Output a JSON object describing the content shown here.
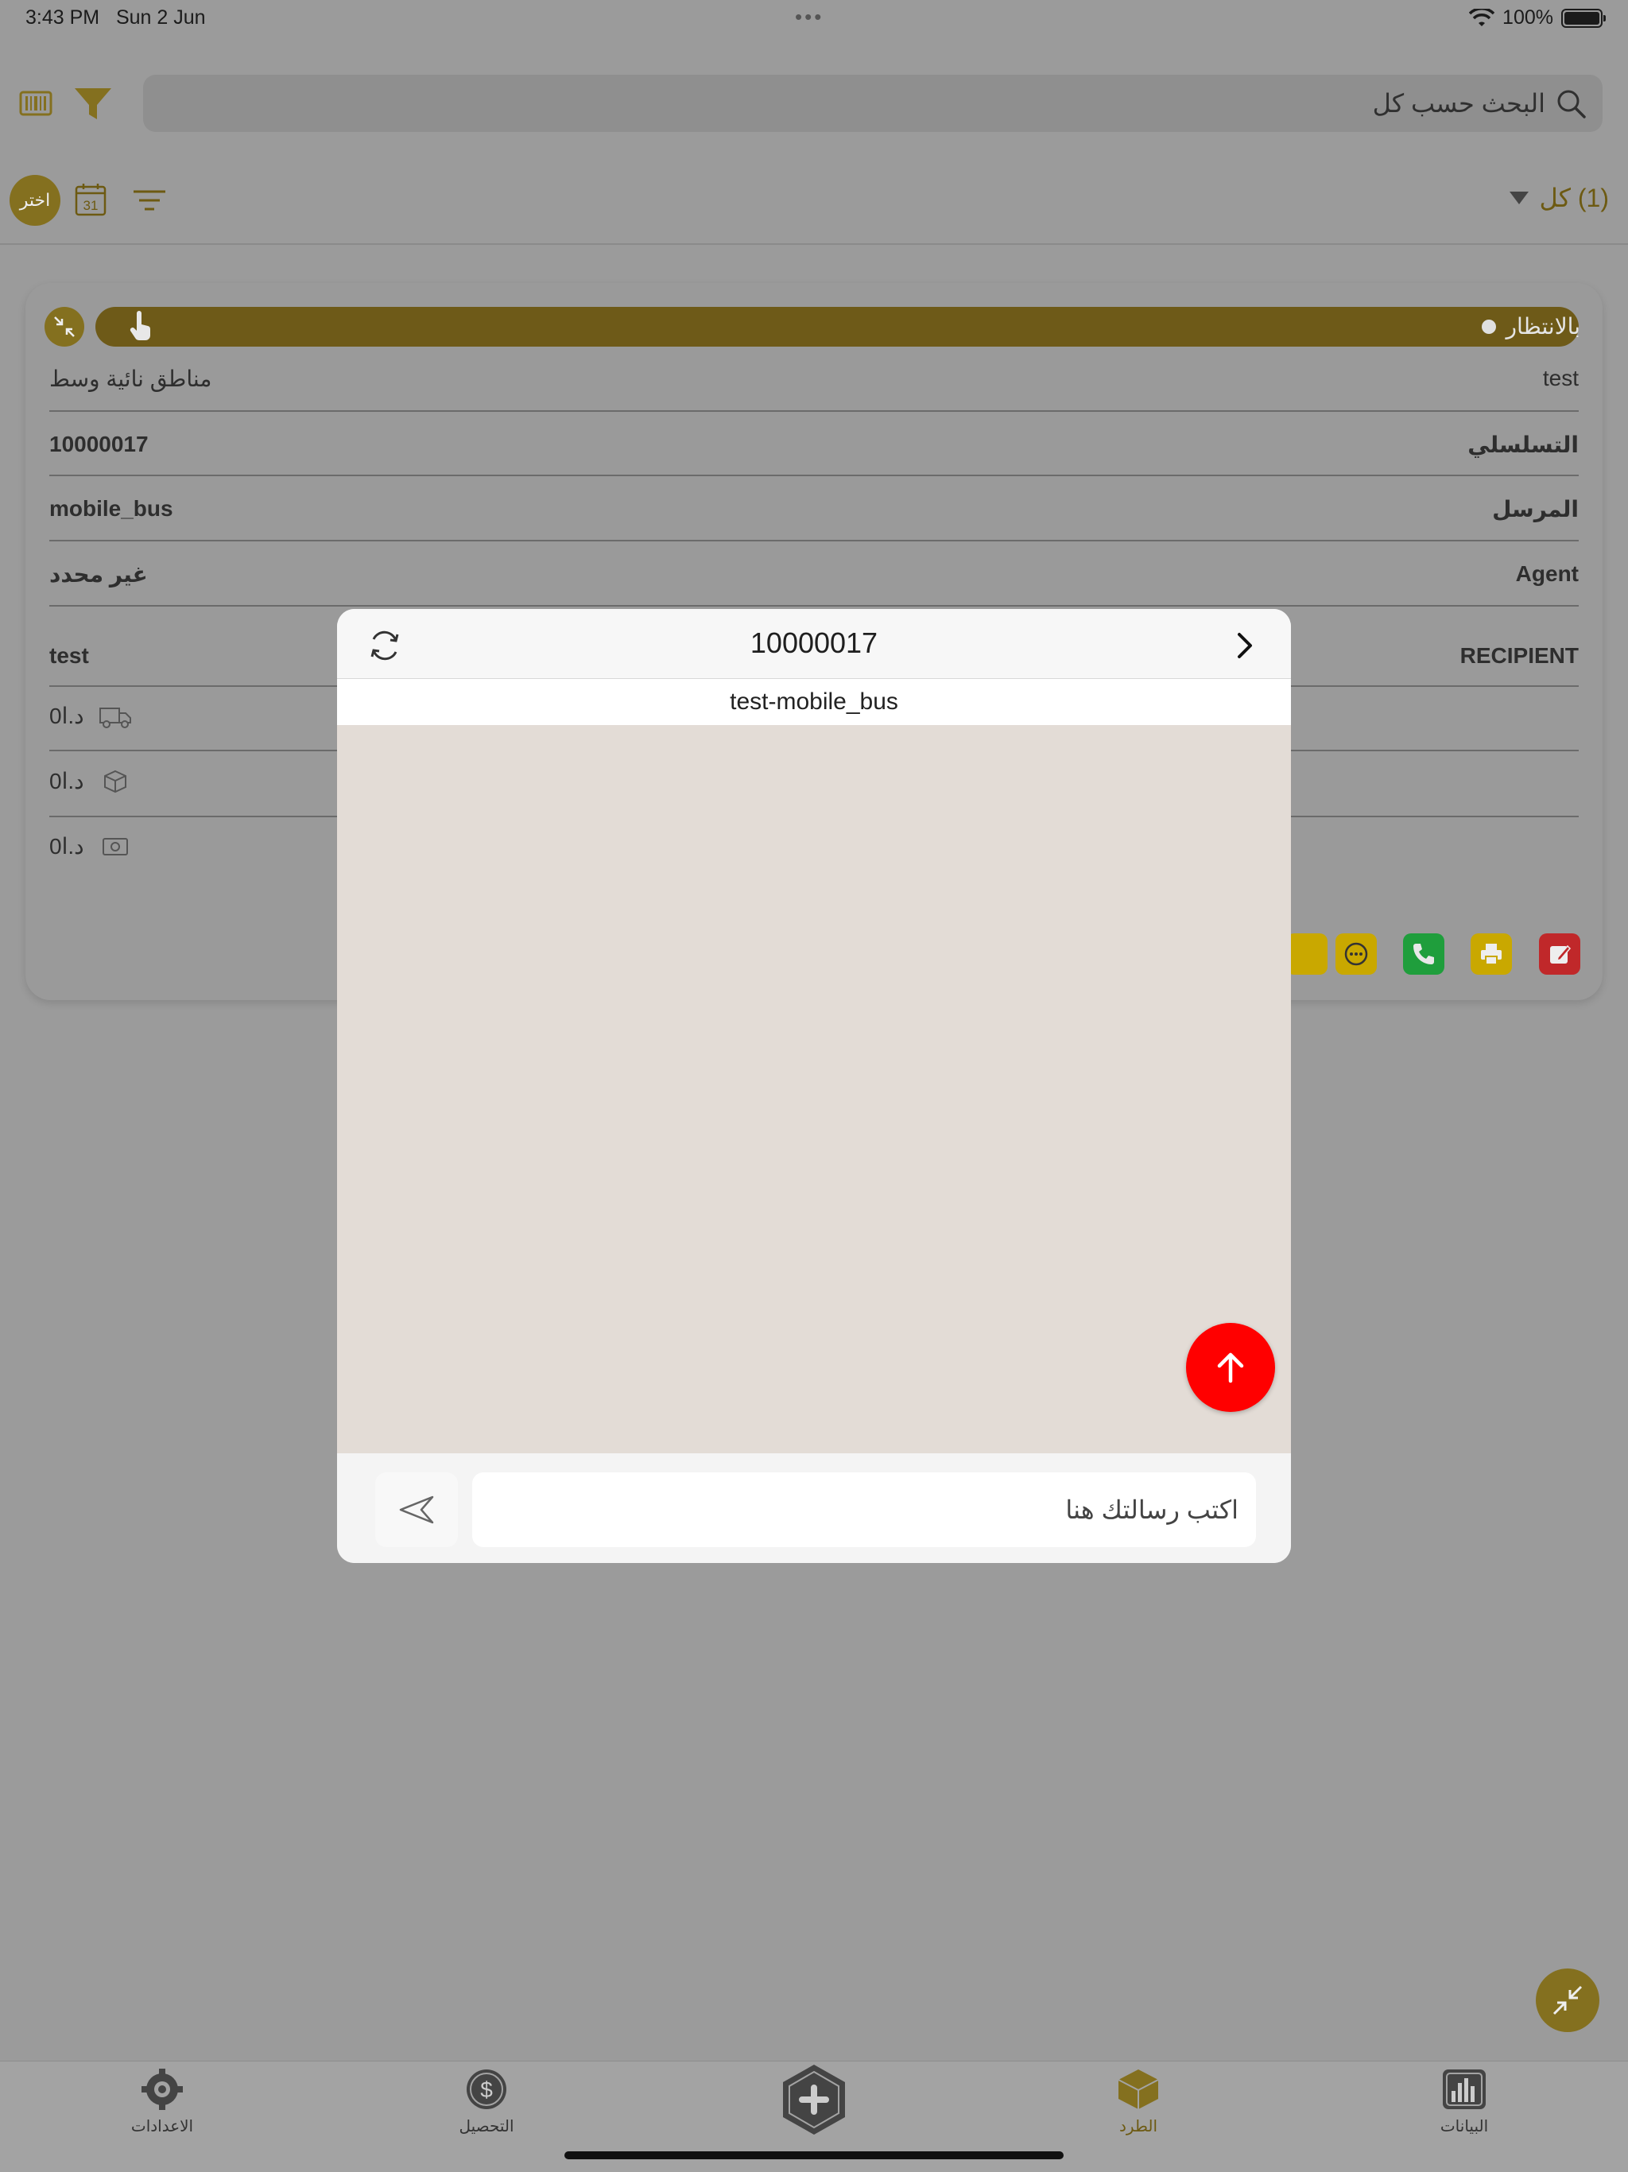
{
  "status_bar": {
    "time": "3:43 PM",
    "date": "Sun 2 Jun",
    "battery": "100%"
  },
  "search": {
    "placeholder": "البحث حسب كل"
  },
  "filters": {
    "choose_label": "اختر",
    "calendar_day": "31",
    "all_label": "(1) كل"
  },
  "card": {
    "status_label": "بالانتظار",
    "rows": [
      {
        "left": "مناطق نائية وسط",
        "right": "test"
      },
      {
        "left": "10000017",
        "right": "التسلسلي"
      },
      {
        "left": "mobile_bus",
        "right": "المرسل"
      },
      {
        "left": "غير محدد",
        "right": "Agent"
      },
      {
        "left": "test",
        "right": "RECIPIENT"
      }
    ],
    "amounts": [
      {
        "value": "0د.ا",
        "icon": "delivery-truck-icon"
      },
      {
        "value": "0د.ا",
        "icon": "package-icon"
      },
      {
        "value": "0د.ا",
        "icon": "cash-icon"
      }
    ]
  },
  "modal": {
    "title": "10000017",
    "subtitle": "test-mobile_bus",
    "input_placeholder": "اكتب رسالتك هنا"
  },
  "tabs": [
    {
      "label": "الاعدادات",
      "icon": "gear-icon"
    },
    {
      "label": "التحصيل",
      "icon": "dollar-icon"
    },
    {
      "label": "",
      "icon": "plus-hexagon-icon"
    },
    {
      "label": "الطرد",
      "icon": "box-icon",
      "active": true
    },
    {
      "label": "البيانات",
      "icon": "bar-chart-icon"
    }
  ],
  "colors": {
    "brand_gold": "#84701f",
    "pill": "#6e5a18",
    "alert_red": "#ff0000",
    "chat_bg": "#e3dcd6"
  }
}
